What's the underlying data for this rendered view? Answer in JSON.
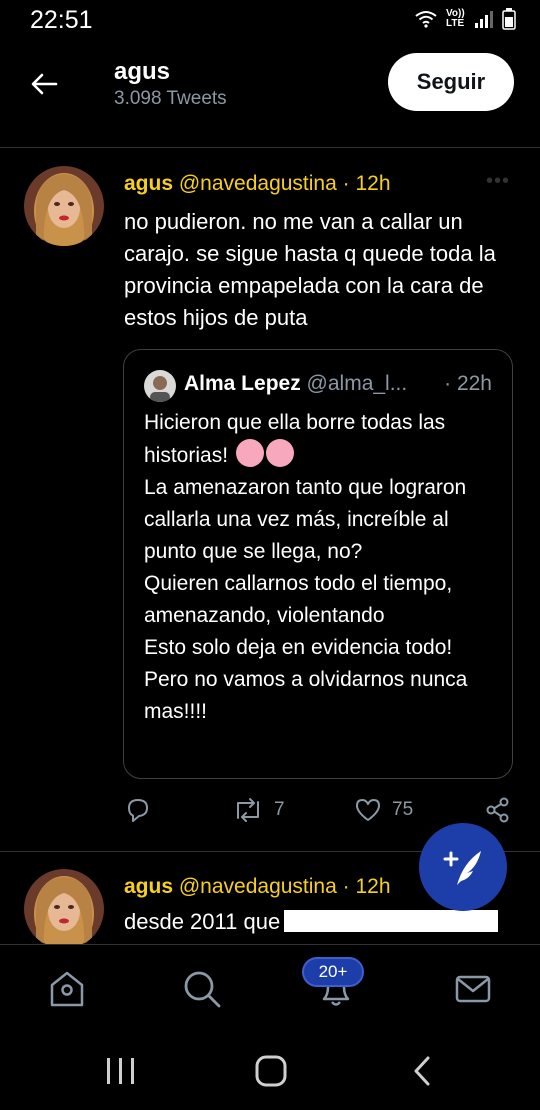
{
  "status": {
    "time": "22:51",
    "network": "Vo)) LTE"
  },
  "header": {
    "name": "agus",
    "tweet_count": "3.098 Tweets",
    "follow_label": "Seguir"
  },
  "tweets": [
    {
      "name": "agus",
      "handle": "@navedagustina",
      "sep": " · ",
      "time": "12h",
      "text": "no pudieron. no me van a callar un carajo. se sigue hasta q quede toda la provincia empapelada con la cara de estos hijos de puta",
      "quote": {
        "name": "Alma Lepez",
        "handle": "@alma_l...",
        "time": "· 22h",
        "text_line1": "Hicieron que ella borre todas las historias!",
        "text_rest": "La amenazaron tanto que lograron callarla una vez más, increíble al punto que se llega, no?\nQuieren callarnos todo el tiempo, amenazando, violentando\nEsto solo deja en evidencia todo!\nPero no vamos a olvidarnos nunca mas!!!!"
      },
      "retweets": "7",
      "likes": "75"
    },
    {
      "name": "agus",
      "handle": "@navedagustina",
      "sep": " · ",
      "time": "12h",
      "text": "desde 2011 que"
    }
  ],
  "nav": {
    "notifications_badge": "20+"
  },
  "colors": {
    "accent": "#f7d01e",
    "fab": "#1d3ea8",
    "muted": "#8b98a5",
    "divider": "#2f3336"
  },
  "icons": [
    "back-arrow-icon",
    "more-icon",
    "reply-icon",
    "retweet-icon",
    "like-icon",
    "share-icon",
    "compose-icon",
    "home-icon",
    "search-icon",
    "notifications-icon",
    "messages-icon",
    "recents-icon",
    "home-button-icon",
    "back-button-icon"
  ]
}
